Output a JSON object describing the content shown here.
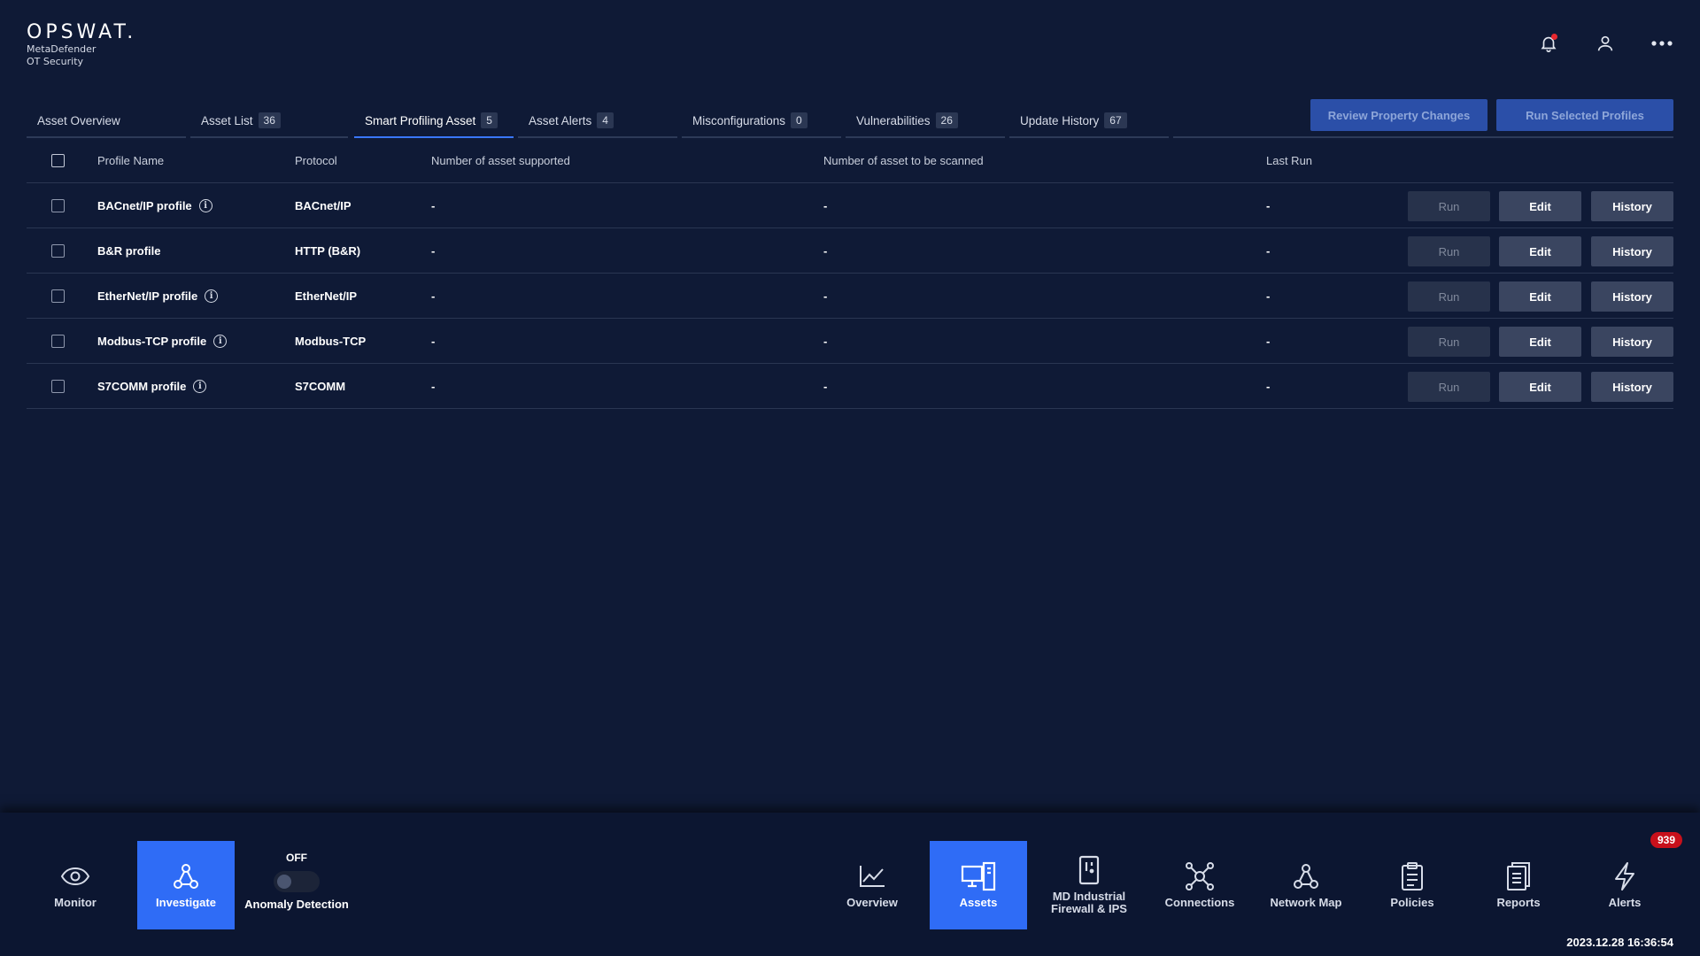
{
  "header": {
    "brand": "OPSWAT.",
    "product_line1": "MetaDefender",
    "product_line2": "OT Security",
    "icons": [
      "bell-icon",
      "user-icon",
      "more-icon"
    ]
  },
  "tabs": [
    {
      "label": "Asset Overview",
      "count": ""
    },
    {
      "label": "Asset List",
      "count": "36"
    },
    {
      "label": "Smart Profiling Asset",
      "count": "5",
      "active": true
    },
    {
      "label": "Asset Alerts",
      "count": "4"
    },
    {
      "label": "Misconfigurations",
      "count": "0"
    },
    {
      "label": "Vulnerabilities",
      "count": "26"
    },
    {
      "label": "Update History",
      "count": "67"
    }
  ],
  "actions": {
    "review": "Review Property Changes",
    "run_selected": "Run Selected Profiles"
  },
  "table": {
    "columns": {
      "name": "Profile Name",
      "protocol": "Protocol",
      "supported": "Number of asset supported",
      "to_scan": "Number of asset to be scanned",
      "last_run": "Last Run"
    },
    "rows": [
      {
        "name": "BACnet/IP profile",
        "info": true,
        "protocol": "BACnet/IP",
        "supported": "-",
        "to_scan": "-",
        "last_run": "-"
      },
      {
        "name": "B&R profile",
        "info": false,
        "protocol": "HTTP (B&R)",
        "supported": "-",
        "to_scan": "-",
        "last_run": "-"
      },
      {
        "name": "EtherNet/IP profile",
        "info": true,
        "protocol": "EtherNet/IP",
        "supported": "-",
        "to_scan": "-",
        "last_run": "-"
      },
      {
        "name": "Modbus-TCP profile",
        "info": true,
        "protocol": "Modbus-TCP",
        "supported": "-",
        "to_scan": "-",
        "last_run": "-"
      },
      {
        "name": "S7COMM profile",
        "info": true,
        "protocol": "S7COMM",
        "supported": "-",
        "to_scan": "-",
        "last_run": "-"
      }
    ],
    "buttons": {
      "run": "Run",
      "edit": "Edit",
      "history": "History"
    },
    "info_glyph": "i"
  },
  "bottom_nav": {
    "monitor": "Monitor",
    "investigate": "Investigate",
    "anomaly_state": "OFF",
    "anomaly_label": "Anomaly Detection",
    "overview": "Overview",
    "assets": "Assets",
    "firewall_line1": "MD Industrial",
    "firewall_line2": "Firewall & IPS",
    "connections": "Connections",
    "network_map": "Network Map",
    "policies": "Policies",
    "reports": "Reports",
    "alerts": "Alerts",
    "alerts_count": "939",
    "timestamp": "2023.12.28 16:36:54"
  },
  "colors": {
    "background": "#0f1a36",
    "accent": "#2f6cf6",
    "badge": "#c8101b"
  }
}
